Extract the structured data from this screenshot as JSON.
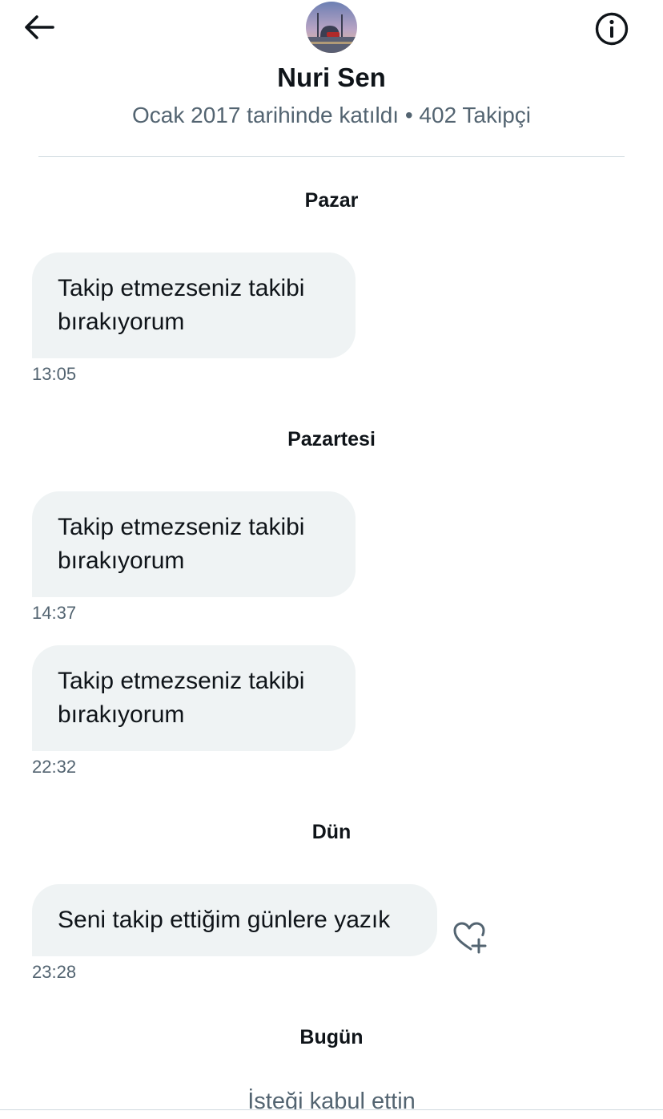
{
  "header": {
    "profile_name": "Nuri Sen",
    "profile_meta": "Ocak 2017 tarihinde katıldı • 402 Takipçi",
    "back_icon": "arrow-left-icon",
    "info_icon": "info-icon"
  },
  "conversation": [
    {
      "day": "Pazar",
      "messages": [
        {
          "text": "Takip etmezseniz takibi bırakıyorum",
          "time": "13:05"
        }
      ]
    },
    {
      "day": "Pazartesi",
      "messages": [
        {
          "text": "Takip etmezseniz takibi bırakıyorum",
          "time": "14:37"
        },
        {
          "text": "Takip etmezseniz takibi bırakıyorum",
          "time": "22:32"
        }
      ]
    },
    {
      "day": "Dün",
      "messages": [
        {
          "text": "Seni takip ettiğim günlere yazık",
          "time": "23:28",
          "reaction_icon": "heart-plus-icon"
        }
      ]
    },
    {
      "day": "Bugün",
      "system_message": "İsteği kabul ettin"
    }
  ],
  "colors": {
    "bubble_bg": "#eff3f4",
    "text_primary": "#0f1419",
    "text_secondary": "#536471",
    "divider": "#cfd9de"
  }
}
